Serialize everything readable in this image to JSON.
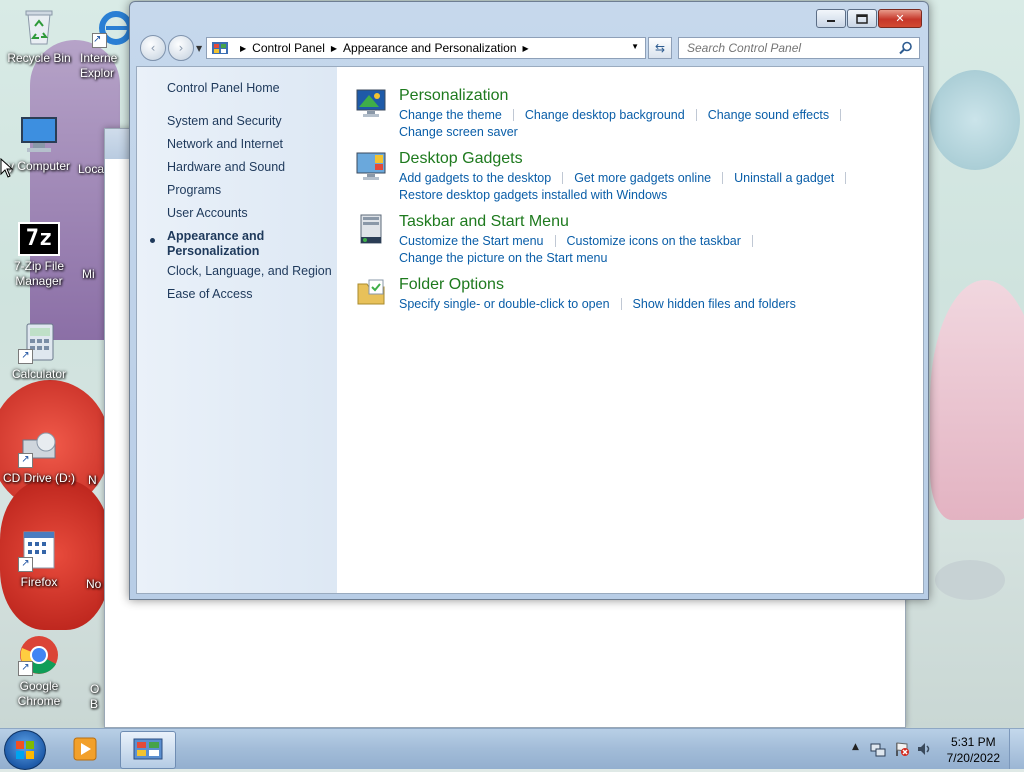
{
  "desktop": {
    "icons": [
      {
        "label": "Recycle Bin"
      },
      {
        "label": "Interne Explor"
      },
      {
        "label": "y Computer"
      },
      {
        "label": "Loca"
      },
      {
        "label": "7-Zip File Manager",
        "glyph": "7z"
      },
      {
        "label": "Mi"
      },
      {
        "label": "Calculator"
      },
      {
        "label": "CD Drive (D:)"
      },
      {
        "label": "N"
      },
      {
        "label": "Firefox"
      },
      {
        "label": "No"
      },
      {
        "label": "Google Chrome"
      },
      {
        "label": "O B"
      }
    ]
  },
  "window": {
    "minimize_icon": "minimize-icon",
    "maximize_icon": "maximize-icon",
    "close_glyph": "✕",
    "nav": {
      "back": "‹",
      "forward": "›"
    },
    "address": {
      "crumbs": [
        "Control Panel",
        "Appearance and Personalization"
      ]
    },
    "search": {
      "placeholder": "Search Control Panel"
    }
  },
  "sidebar": {
    "items": [
      {
        "label": "Control Panel Home"
      },
      {
        "label": "System and Security"
      },
      {
        "label": "Network and Internet"
      },
      {
        "label": "Hardware and Sound"
      },
      {
        "label": "Programs"
      },
      {
        "label": "User Accounts"
      },
      {
        "label": "Appearance and Personalization",
        "active": true
      },
      {
        "label": "Clock, Language, and Region"
      },
      {
        "label": "Ease of Access"
      }
    ]
  },
  "categories": [
    {
      "title": "Personalization",
      "icon": "personalization-icon",
      "links": [
        "Change the theme",
        "Change desktop background",
        "Change sound effects",
        "Change screen saver"
      ]
    },
    {
      "title": "Desktop Gadgets",
      "icon": "desktop-gadgets-icon",
      "links": [
        "Add gadgets to the desktop",
        "Get more gadgets online",
        "Uninstall a gadget",
        "Restore desktop gadgets installed with Windows"
      ]
    },
    {
      "title": "Taskbar and Start Menu",
      "icon": "taskbar-icon",
      "links": [
        "Customize the Start menu",
        "Customize icons on the taskbar",
        "Change the picture on the Start menu"
      ]
    },
    {
      "title": "Folder Options",
      "icon": "folder-options-icon",
      "links": [
        "Specify single- or double-click to open",
        "Show hidden files and folders"
      ]
    }
  ],
  "taskbar": {
    "clock": {
      "time": "5:31 PM",
      "date": "7/20/2022"
    }
  },
  "colors": {
    "category_title": "#1e7a1e",
    "link": "#0a5ea8",
    "sidebar_text": "#1e395b"
  }
}
